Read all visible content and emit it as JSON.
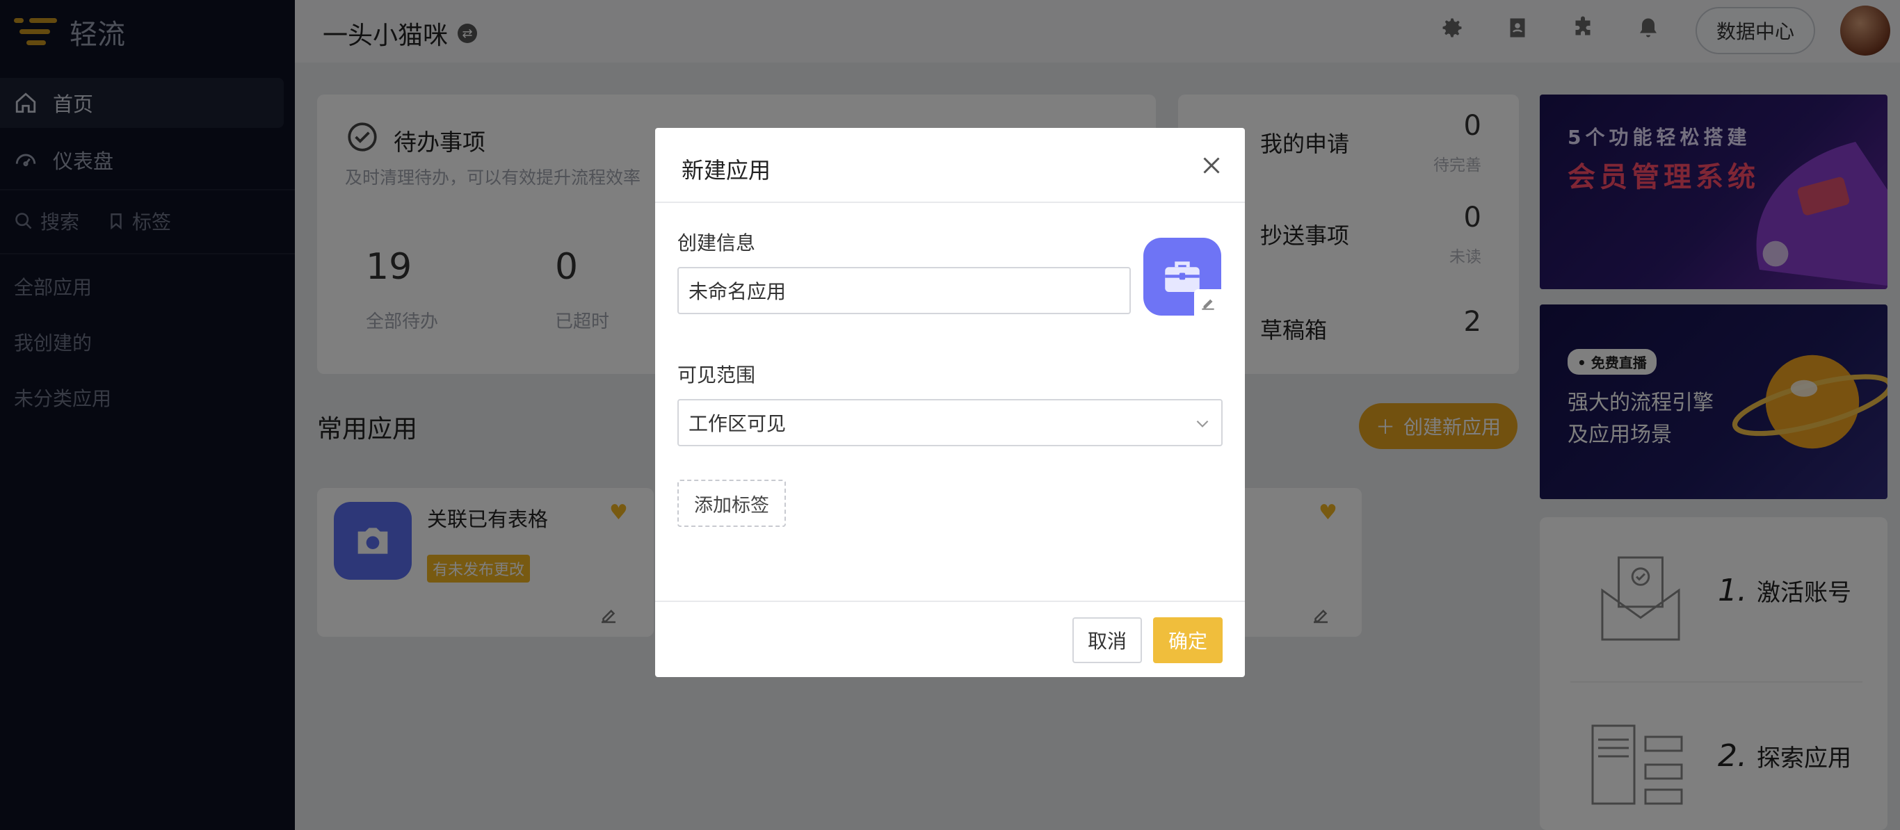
{
  "brand": {
    "name": "轻流"
  },
  "sidebar": {
    "items": [
      {
        "label": "首页",
        "icon": "home-icon",
        "active": true
      },
      {
        "label": "仪表盘",
        "icon": "dashboard-icon",
        "active": false
      }
    ],
    "search_label": "搜索",
    "tag_label": "标签",
    "groups": [
      "全部应用",
      "我创建的",
      "未分类应用"
    ]
  },
  "topbar": {
    "workspace_title": "一头小猫咪",
    "icons": [
      "settings-icon",
      "contacts-icon",
      "plugin-icon",
      "bell-icon",
      "help-icon"
    ],
    "data_center_label": "数据中心"
  },
  "todo": {
    "title": "待办事项",
    "subtitle": "及时清理待办，可以有效提升流程效率",
    "stats": [
      {
        "value": "19",
        "label": "全部待办"
      },
      {
        "value": "0",
        "label": "已超时"
      }
    ]
  },
  "my_items": [
    {
      "title": "我的申请",
      "count": "0",
      "sub": "待完善"
    },
    {
      "title": "抄送事项",
      "count": "0",
      "sub": "未读"
    },
    {
      "title": "草稿箱",
      "count": "2",
      "sub": ""
    }
  ],
  "common_apps": {
    "title": "常用应用",
    "create_label": "创建新应用",
    "apps": [
      {
        "name": "关联已有表格",
        "badge": "有未发布更改"
      }
    ]
  },
  "banners": {
    "b1_top": "5个功能轻松搭建",
    "b1_big": "会员管理系统",
    "b2_tag": "• 免费直播",
    "b2_line1": "强大的流程引擎",
    "b2_line2": "及应用场景"
  },
  "steps": [
    {
      "num": "1.",
      "label": "激活账号"
    },
    {
      "num": "2.",
      "label": "探索应用"
    }
  ],
  "modal": {
    "title": "新建应用",
    "create_info_label": "创建信息",
    "name_value": "未命名应用",
    "visibility_label": "可见范围",
    "visibility_value": "工作区可见",
    "add_tag_label": "添加标签",
    "cancel_label": "取消",
    "confirm_label": "确定"
  },
  "colors": {
    "accent": "#f0be3c",
    "brand_orange": "#e5a21f",
    "sidebar_bg": "#0d1123",
    "app_icon": "#6e74f5"
  }
}
